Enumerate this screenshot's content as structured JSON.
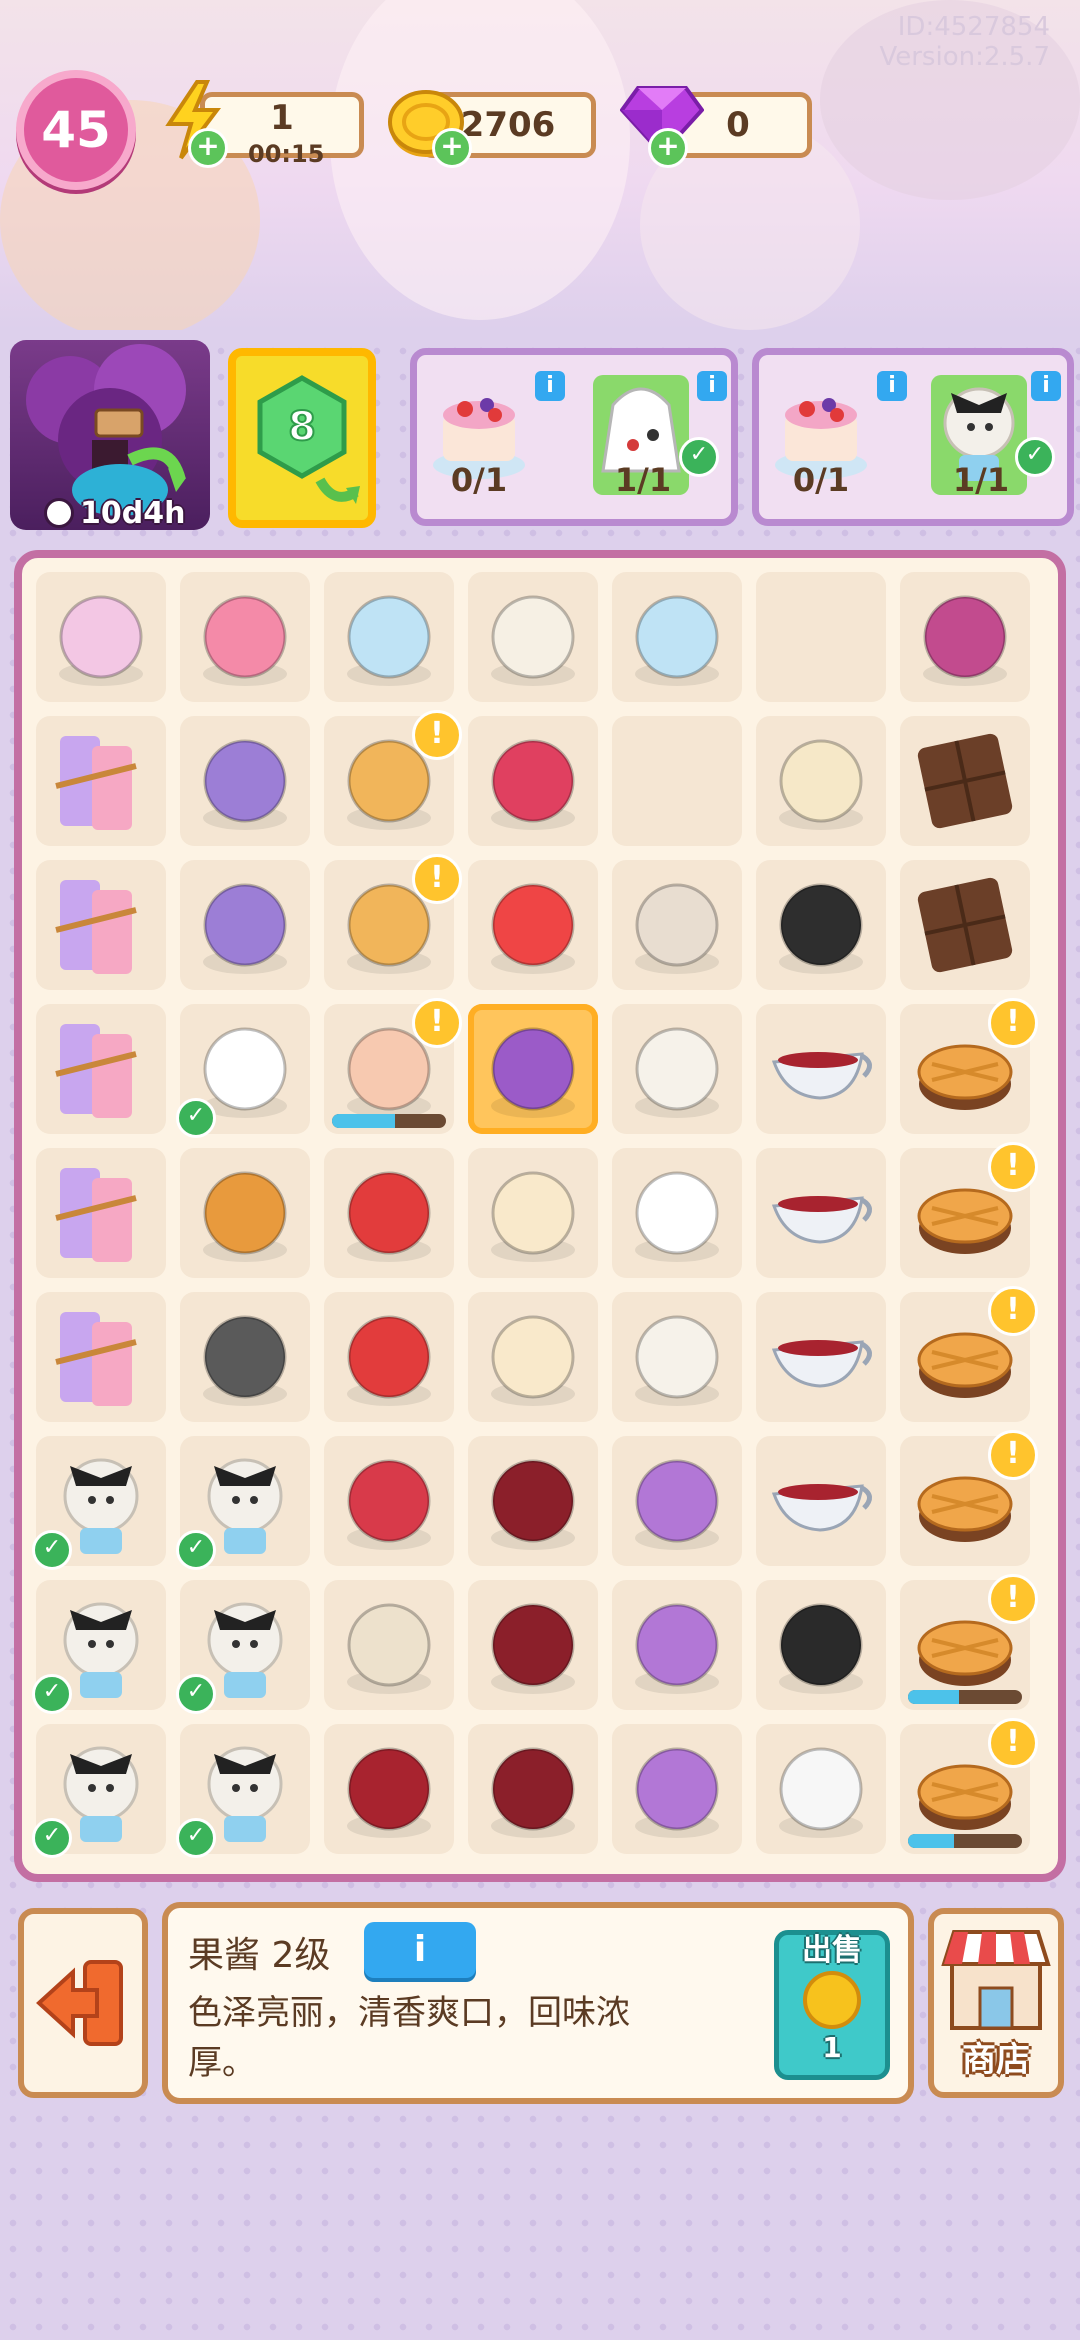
{
  "header": {
    "id_text": "ID:4527854",
    "version_text": "Version:2.5.7",
    "level": "45",
    "energy": {
      "value": "1",
      "timer": "00:15",
      "icon": "lightning-icon"
    },
    "coins": {
      "value": "2706",
      "icon": "coin-icon"
    },
    "gems": {
      "value": "0",
      "icon": "gem-icon"
    }
  },
  "event": {
    "timer": "10d4h",
    "hex_level": "8"
  },
  "orders": [
    {
      "items": [
        {
          "icon": "berry-cake-icon",
          "count": "0/1"
        },
        {
          "icon": "rabbit-bag-icon",
          "count": "1/1",
          "done": true
        }
      ]
    },
    {
      "items": [
        {
          "icon": "berry-cake-icon",
          "count": "0/1"
        },
        {
          "icon": "alice-doll-icon",
          "count": "1/1",
          "done": true
        }
      ]
    }
  ],
  "board": {
    "rows": [
      [
        "energy-chest",
        "pincushion",
        "tea-table",
        "tea-party",
        "tea-table",
        "",
        "toaster-oven"
      ],
      [
        "thread-spools",
        "thread-spool",
        "pancake-stand",
        "raspberries",
        "",
        "berry-bowl",
        "chocolate-bar"
      ],
      [
        "thread-spools",
        "thread-spool",
        "pancake-stand",
        "strawberries",
        "pocket-watch",
        "oreo-cookie",
        "chocolate-bar"
      ],
      [
        "thread-spools",
        "rabbit-bag",
        "berry-cake",
        "jam-jar",
        "tea-cup",
        "gravy-boat",
        "waffle"
      ],
      [
        "thread-spools",
        "pancake-stack",
        "card-soldier",
        "fruit-tart",
        "tea-pot",
        "gravy-boat",
        "waffle"
      ],
      [
        "thread-spools",
        "crow-web",
        "card-soldier",
        "fruit-tart",
        "tea-cups",
        "gravy-boat",
        "waffle"
      ],
      [
        "alice-doll",
        "alice-doll",
        "heart-scepter",
        "queen-cloak",
        "cheshire-cat",
        "gravy-boat",
        "waffle"
      ],
      [
        "alice-doll",
        "alice-doll",
        "card-book",
        "queen-cloak",
        "cheshire-cat",
        "ribbon-bow",
        "waffle"
      ],
      [
        "alice-doll",
        "alice-doll",
        "queen-hearts",
        "queen-cloak",
        "cheshire-cat",
        "white-rabbit",
        "waffle"
      ]
    ],
    "selected": "jam-jar"
  },
  "selected_item": {
    "name": "果酱 2级",
    "info_label": "i",
    "description": "色泽亮丽，清香爽口，回味浓厚。",
    "sell_label": "出售",
    "sell_value": "1"
  },
  "shop_label": "商店",
  "colors": {
    "accent_pink": "#e05a9c",
    "board_border": "#c36fa3",
    "sell_teal": "#3fc9c9",
    "info_blue": "#33a8f0"
  }
}
